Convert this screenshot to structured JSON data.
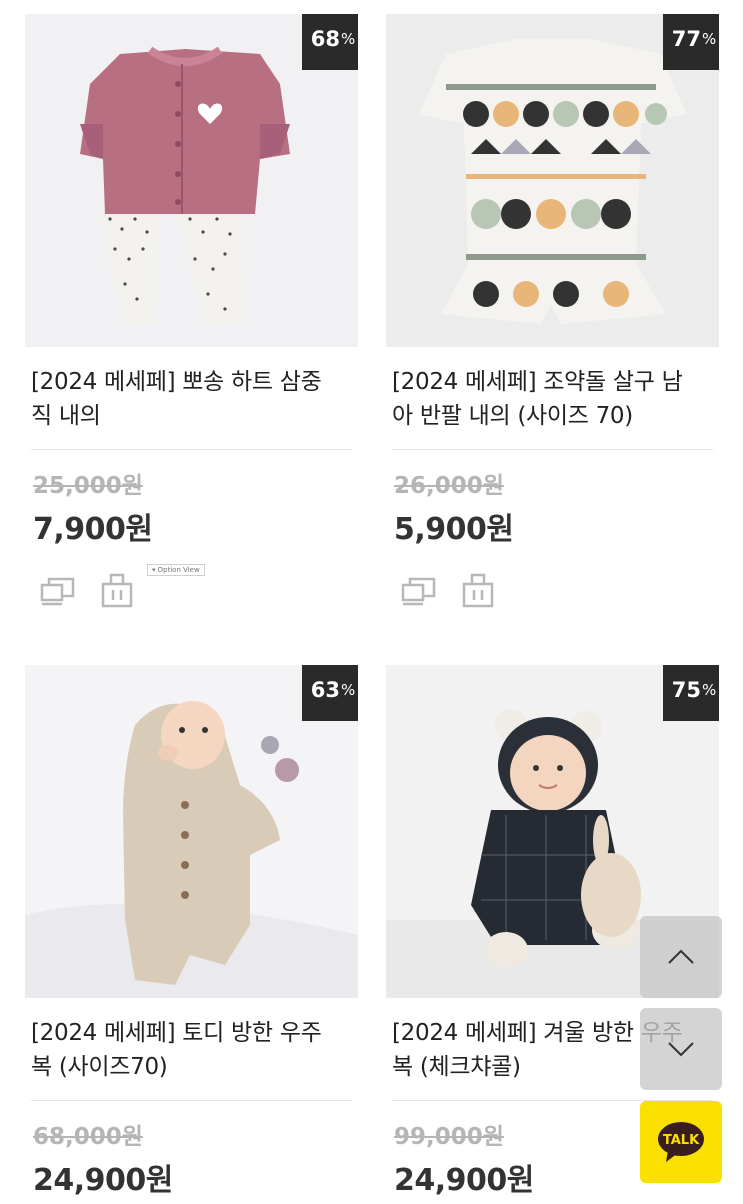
{
  "colors": {
    "badge_bg": "#2a2a2a",
    "talk_bg": "#f9e000",
    "original_price": "#b5b5b5",
    "sale_price": "#333333"
  },
  "products": [
    {
      "discount": "68",
      "discount_unit": "%",
      "title_line1": "[2024 메세페] 뽀송 하트 삼중",
      "title_line2": "직 내의",
      "original_price": "25,000원",
      "sale_price": "7,900원",
      "image": "pink-heart-cardigan-polka-pants"
    },
    {
      "discount": "77",
      "discount_unit": "%",
      "title_line1": "[2024 메세페] 조약돌 살구 남",
      "title_line2": "아 반팔 내의 (사이즈 70)",
      "original_price": "26,000원",
      "sale_price": "5,900원",
      "image": "pebble-pattern-short-set"
    },
    {
      "discount": "63",
      "discount_unit": "%",
      "title_line1": "[2024 메세페] 토디 방한 우주",
      "title_line2": "복 (사이즈70)",
      "original_price": "68,000원",
      "sale_price": "24,900원",
      "image": "baby-beige-fleece-suit"
    },
    {
      "discount": "75",
      "discount_unit": "%",
      "title_line1": "[2024 메세페] 겨울 방한 우주",
      "title_line2": "복 (체크챠콜)",
      "original_price": "99,000원",
      "sale_price": "24,900원",
      "image": "baby-charcoal-check-suit"
    }
  ],
  "option_view_label": "Option View",
  "icons": {
    "compare": "compare-icon",
    "cart": "cart-icon",
    "scroll_up": "chevron-up-icon",
    "scroll_down": "chevron-down-icon"
  },
  "talk_label": "TALK"
}
